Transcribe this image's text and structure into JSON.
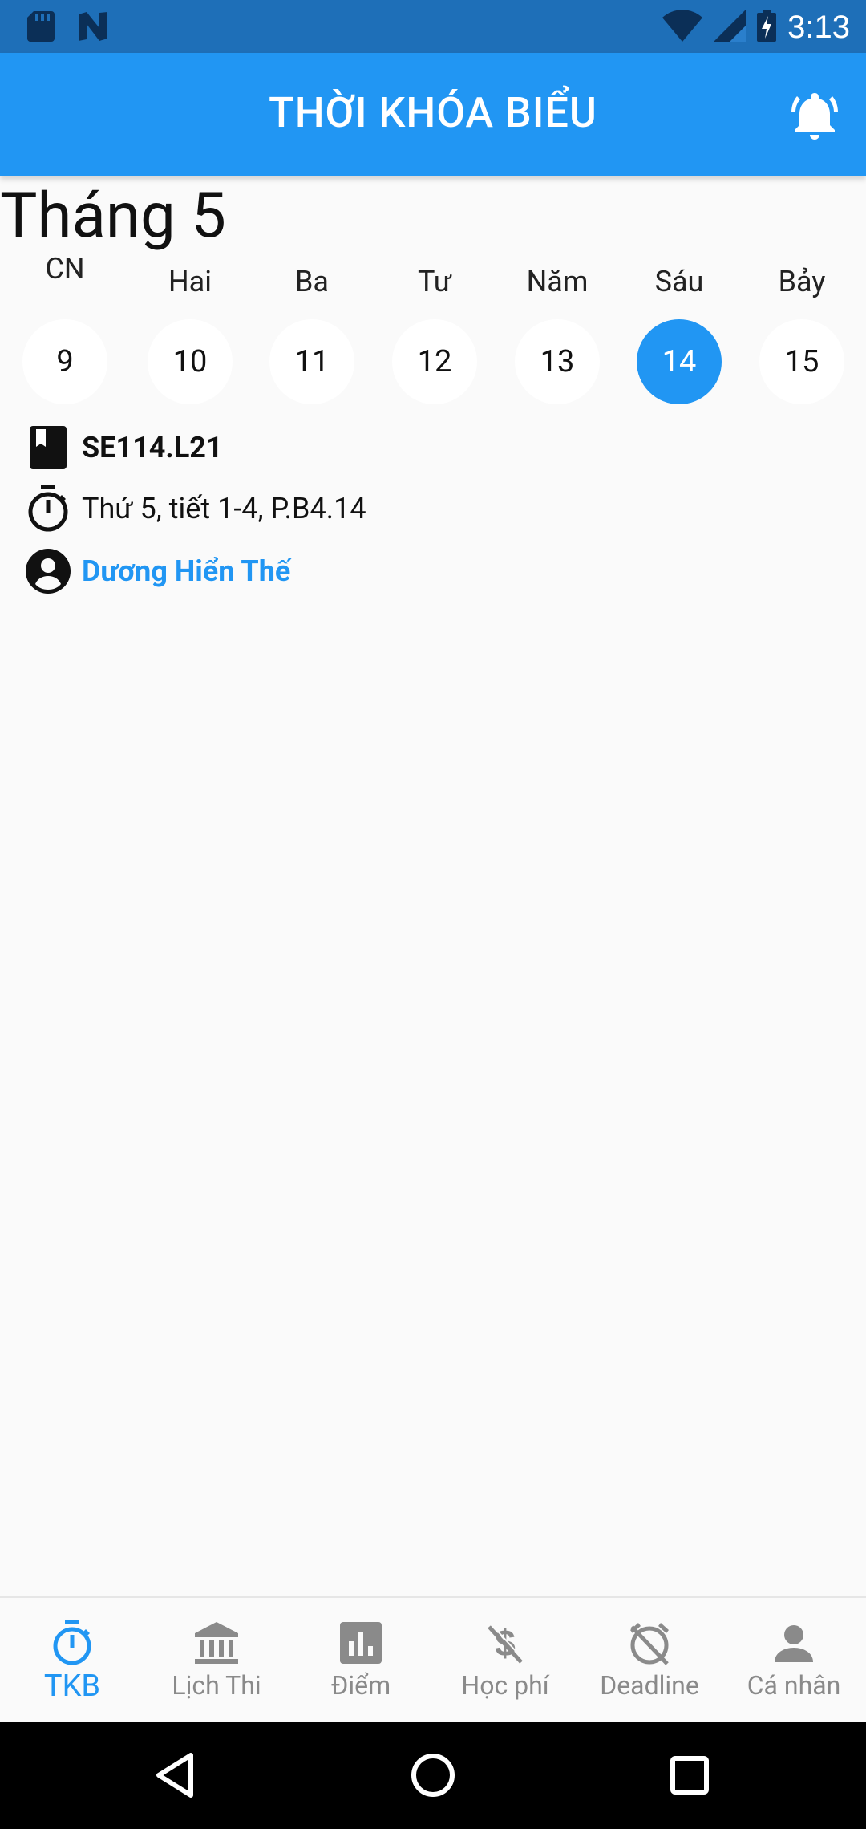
{
  "status_bar": {
    "time": "3:13"
  },
  "app_bar": {
    "title": "THỜI KHÓA BIỂU"
  },
  "calendar": {
    "month_title": "Tháng 5",
    "weekdays": [
      "CN",
      "Hai",
      "Ba",
      "Tư",
      "Năm",
      "Sáu",
      "Bảy"
    ],
    "days": [
      "9",
      "10",
      "11",
      "12",
      "13",
      "14",
      "15"
    ],
    "selected_day": "14"
  },
  "schedule": {
    "course_code": "SE114.L21",
    "time_room": "Thứ 5, tiết 1-4, P.B4.14",
    "teacher": "Dương Hiển Thế"
  },
  "bottom_nav": {
    "items": [
      {
        "label": "TKB",
        "icon": "timer-icon"
      },
      {
        "label": "Lịch Thi",
        "icon": "bank-icon"
      },
      {
        "label": "Điểm",
        "icon": "chart-icon"
      },
      {
        "label": "Học phí",
        "icon": "money-off-icon"
      },
      {
        "label": "Deadline",
        "icon": "alarm-off-icon"
      },
      {
        "label": "Cá nhân",
        "icon": "person-icon"
      }
    ],
    "active_index": 0
  },
  "colors": {
    "primary": "#2196f3",
    "status_bar": "#1e6fb8",
    "inactive": "#8a8a8a"
  }
}
